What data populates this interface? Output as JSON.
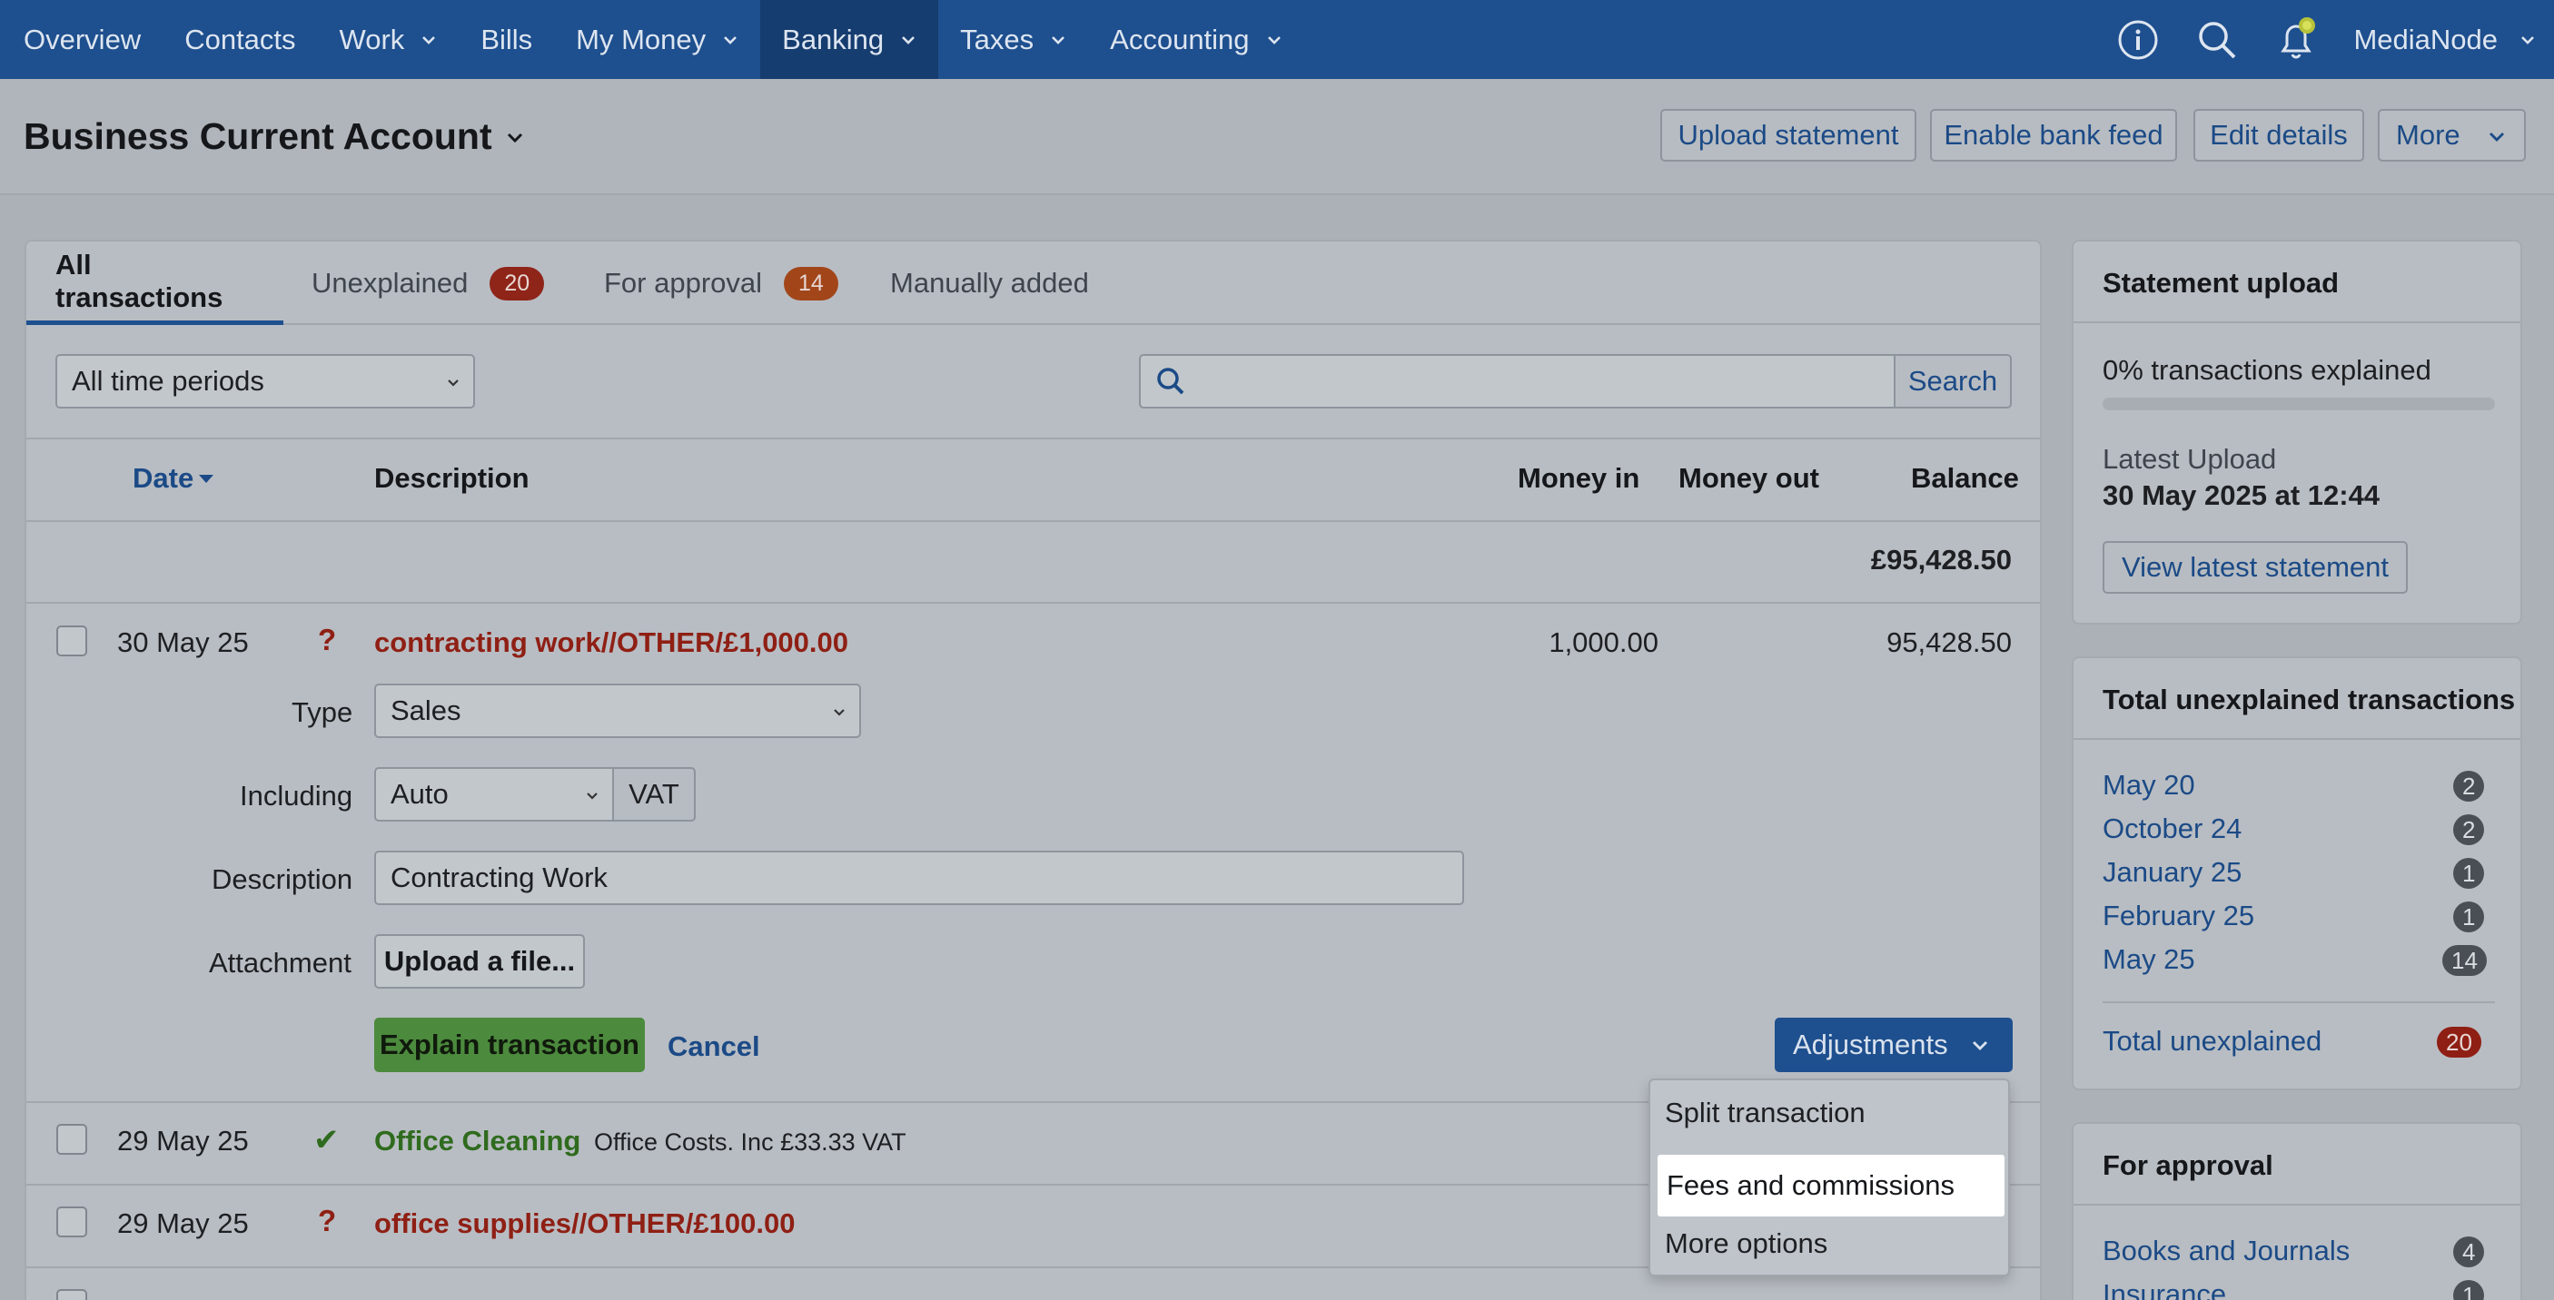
{
  "nav": {
    "items": [
      {
        "label": "Overview",
        "dropdown": false
      },
      {
        "label": "Contacts",
        "dropdown": false
      },
      {
        "label": "Work",
        "dropdown": true
      },
      {
        "label": "Bills",
        "dropdown": false
      },
      {
        "label": "My Money",
        "dropdown": true
      },
      {
        "label": "Banking",
        "dropdown": true,
        "active": true
      },
      {
        "label": "Taxes",
        "dropdown": true
      },
      {
        "label": "Accounting",
        "dropdown": true
      }
    ],
    "user": "MediaNode",
    "icons": [
      "info-icon",
      "search-icon",
      "bell-icon"
    ]
  },
  "header": {
    "title": "Business Current Account",
    "buttons": [
      "Upload statement",
      "Enable bank feed",
      "Edit details",
      "More"
    ]
  },
  "tabs": [
    {
      "label": "All transactions",
      "active": true
    },
    {
      "label": "Unexplained",
      "badge": "20"
    },
    {
      "label": "For approval",
      "badge": "14"
    },
    {
      "label": "Manually added"
    }
  ],
  "filters": {
    "period": "All time periods",
    "search_button": "Search"
  },
  "table": {
    "columns": [
      "Date",
      "Description",
      "Money in",
      "Money out",
      "Balance"
    ],
    "opening_balance": "£95,428.50",
    "expanded_row": {
      "date": "30 May 25",
      "status": "?",
      "description": "contracting work//OTHER/£1,000.00",
      "money_in": "1,000.00",
      "balance": "95,428.50"
    },
    "form": {
      "type_label": "Type",
      "type_value": "Sales",
      "including_label": "Including",
      "including_value": "Auto",
      "vat_label": "VAT",
      "description_label": "Description",
      "description_value": "Contracting Work",
      "attachment_label": "Attachment",
      "upload_button": "Upload a file...",
      "explain_button": "Explain transaction",
      "cancel": "Cancel",
      "adjustments": "Adjustments"
    },
    "rows": [
      {
        "date": "29 May 25",
        "status": "✔",
        "description": "Office Cleaning",
        "detail": "Office Costs. Inc £33.33 VAT"
      },
      {
        "date": "29 May 25",
        "status": "?",
        "description": "office supplies//OTHER/£100.00"
      }
    ]
  },
  "adjustments_menu": {
    "items": [
      "Split transaction",
      "Fees and commissions",
      "More options"
    ],
    "highlighted": "Fees and commissions"
  },
  "sidebar": {
    "statement_upload": {
      "title": "Statement upload",
      "explained": "0% transactions explained",
      "explained_fraction": 0,
      "latest_label": "Latest Upload",
      "latest_value": "30 May 2025 at 12:44",
      "view_button": "View latest statement"
    },
    "unexplained": {
      "title": "Total unexplained transactions",
      "items": [
        {
          "label": "May 20",
          "count": "2"
        },
        {
          "label": "October 24",
          "count": "2"
        },
        {
          "label": "January 25",
          "count": "1"
        },
        {
          "label": "February 25",
          "count": "1"
        },
        {
          "label": "May 25",
          "count": "14"
        }
      ],
      "total_label": "Total unexplained",
      "total_count": "20"
    },
    "approval": {
      "title": "For approval",
      "items": [
        {
          "label": "Books and Journals",
          "count": "4"
        },
        {
          "label": "Insurance",
          "count": "1"
        }
      ]
    }
  },
  "colors": {
    "nav_bg": "#1e4f8e",
    "link": "#1b4a86",
    "unexplained_red": "#8f1f14",
    "explained_green": "#2f6b1e",
    "button_green": "#4c8a3d"
  }
}
